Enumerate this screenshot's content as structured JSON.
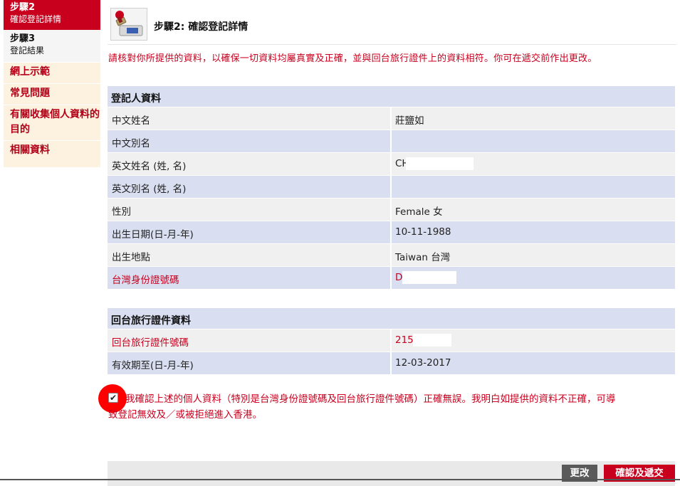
{
  "sidebar": {
    "step2": {
      "title": "步驟2",
      "subtitle": "確認登記詳情"
    },
    "step3": {
      "title": "步驟3",
      "subtitle": "登記結果"
    },
    "links": [
      "網上示範",
      "常見問題",
      "有關收集個人資料的目的",
      "相關資料"
    ]
  },
  "header": {
    "title": "步驟2: 確認登記詳情"
  },
  "intro": "請核對你所提供的資料，以確保一切資料均屬真實及正確，並與回台旅行證件上的資料相符。你可在遞交前作出更改。",
  "registrant": {
    "header": "登記人資料",
    "rows": [
      {
        "label": "中文姓名",
        "value": "莊鹽如"
      },
      {
        "label": "中文別名",
        "value": ""
      },
      {
        "label": "英文姓名 (姓, 名)",
        "value": "CH"
      },
      {
        "label": "英文別名 (姓, 名)",
        "value": ""
      },
      {
        "label": "性別",
        "value": "Female 女"
      },
      {
        "label": "出生日期(日-月-年)",
        "value": "10-11-1988"
      },
      {
        "label": "出生地點",
        "value": "Taiwan 台灣"
      },
      {
        "label": "台灣身份證號碼",
        "value": "D"
      }
    ]
  },
  "travel_doc": {
    "header": "回台旅行證件資料",
    "rows": [
      {
        "label": "回台旅行證件號碼",
        "value": "215"
      },
      {
        "label": "有效期至(日-月-年)",
        "value": "12-03-2017"
      }
    ]
  },
  "declaration": {
    "checked": true,
    "line1": "我確認上述的個人資料（特別是台灣身份證號碼及回台旅行證件號碼）正確無誤。我明白如提供的資料不正確，可導",
    "line2": "致登記無效及／或被拒絕進入香港。"
  },
  "buttons": {
    "edit": "更改",
    "submit": "確認及遞交"
  },
  "colors": {
    "accent_red": "#c8001e",
    "row_blue": "#d9dff1",
    "row_grey": "#f0f0f0",
    "side_bg": "#fdf2df"
  }
}
